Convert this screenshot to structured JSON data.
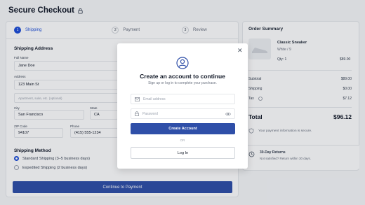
{
  "page": {
    "title": "Secure Checkout"
  },
  "steps": [
    {
      "num": "1",
      "label": "Shipping"
    },
    {
      "num": "2",
      "label": "Payment"
    },
    {
      "num": "3",
      "label": "Review"
    }
  ],
  "shipping": {
    "title": "Shipping Address",
    "full_name_label": "Full Name",
    "full_name": "Jane Doe",
    "address_label": "Address",
    "address": "123 Main St",
    "address2_placeholder": "Apartment, suite, etc. (optional)",
    "city_label": "City",
    "city": "San Francisco",
    "state_label": "State",
    "state": "CA",
    "zip_label": "ZIP Code",
    "zip": "94107",
    "phone_label": "Phone",
    "phone": "(415) 555-1234"
  },
  "method": {
    "title": "Shipping Method",
    "options": [
      {
        "label": "Standard Shipping (3–5 business days)",
        "selected": true
      },
      {
        "label": "Expedited Shipping (2 business days)",
        "selected": false
      }
    ]
  },
  "cta": {
    "label": "Continue to Payment"
  },
  "summary": {
    "title": "Order Summary",
    "product_name": "Classic Sneaker",
    "product_variant": "White / 9",
    "product_qty": "Qty: 1",
    "product_price": "$89.00",
    "subtotal_label": "Subtotal",
    "subtotal": "$89.00",
    "shipping_label": "Shipping",
    "shipping": "$0.00",
    "tax_label": "Tax",
    "tax": "$7.12",
    "total_label": "Total",
    "total": "$96.12",
    "secure_note": "Your payment information is secure.",
    "returns_title": "30-Day Returns",
    "returns_sub": "Not satisfied? Return within 30 days."
  },
  "modal": {
    "title": "Create an account to continue",
    "subtitle": "Sign up or log in to complete your purchase.",
    "email_placeholder": "Email address",
    "password_placeholder": "Password",
    "create_label": "Create Account",
    "or_label": "OR",
    "login_label": "Log In"
  }
}
